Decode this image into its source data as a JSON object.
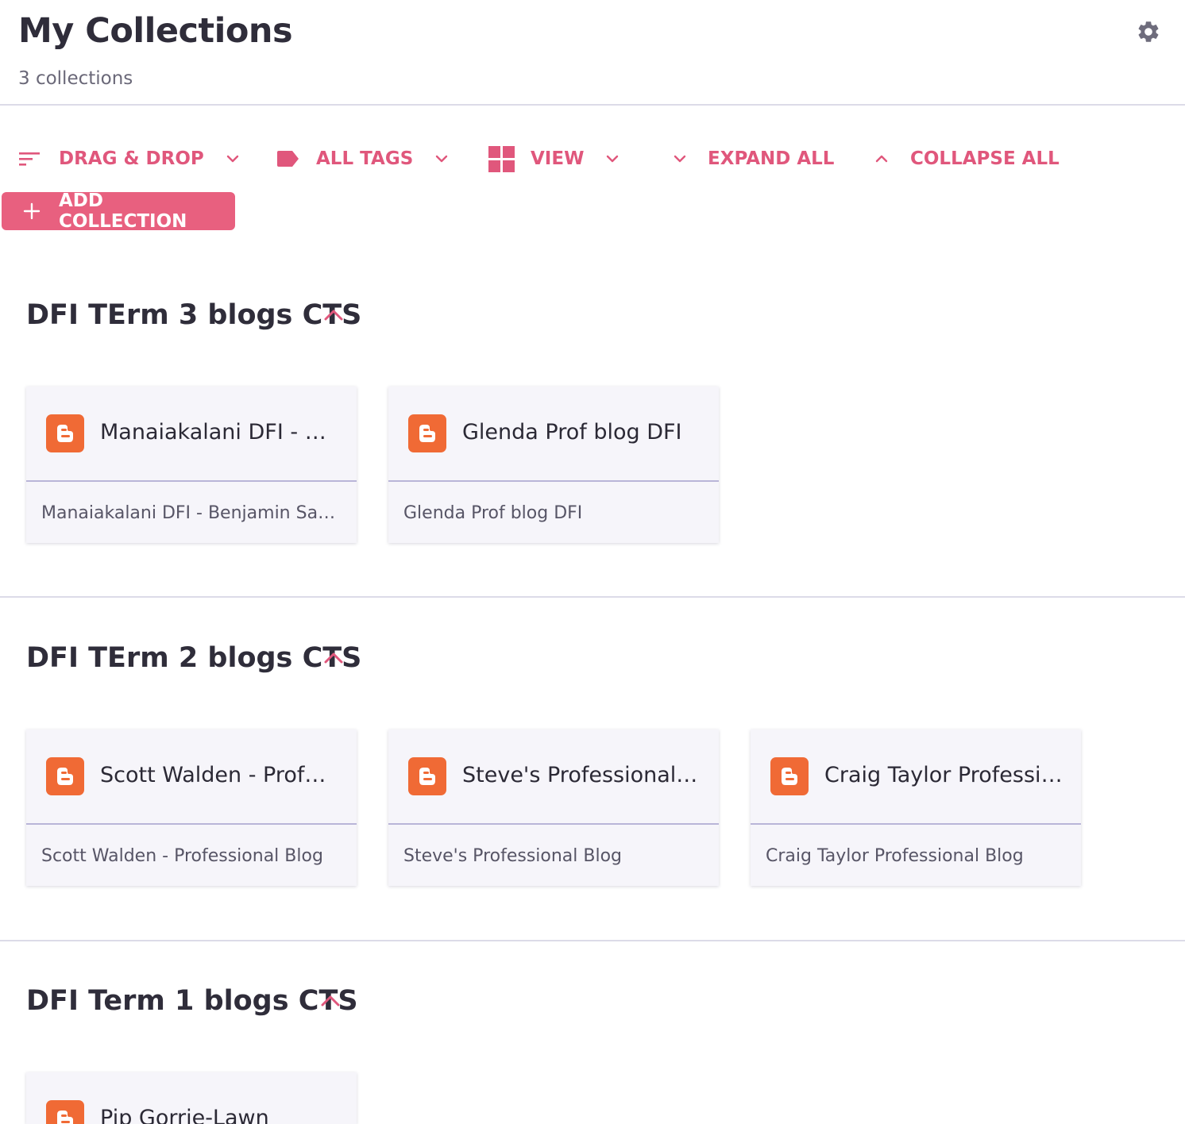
{
  "header": {
    "title": "My Collections",
    "count": "3 collections"
  },
  "toolbar": {
    "drag_drop": "DRAG & DROP",
    "all_tags": "ALL TAGS",
    "view": "VIEW",
    "expand_all": "EXPAND ALL",
    "collapse_all": "COLLAPSE ALL",
    "add_collection": "ADD COLLECTION"
  },
  "colors": {
    "accent": "#e0577c",
    "button": "#e8607f",
    "blogger": "#f06a35"
  },
  "icons": {
    "settings": "gear-icon",
    "sort": "sort-icon",
    "tag": "tag-icon",
    "view": "grid-icon",
    "dropdown": "chevron-down-icon",
    "collapse": "chevron-up-icon",
    "add": "plus-icon",
    "bookmark": "blogger-icon"
  },
  "collections": [
    {
      "title": "DFI TErm 3 blogs CTS",
      "items": [
        {
          "title": "Manaiakalani DFI - Benjamin Sapolu",
          "description": "Manaiakalani DFI - Benjamin Sapolu"
        },
        {
          "title": "Glenda Prof blog DFI",
          "description": "Glenda Prof blog DFI"
        }
      ]
    },
    {
      "title": "DFI TErm 2 blogs CTS",
      "items": [
        {
          "title": "Scott Walden - Professional Blog",
          "description": "Scott Walden - Professional Blog"
        },
        {
          "title": "Steve's Professional Blog",
          "description": "Steve's Professional Blog"
        },
        {
          "title": "Craig Taylor Professional Blog",
          "description": "Craig Taylor Professional Blog"
        }
      ]
    },
    {
      "title": "DFI Term 1 blogs CTS",
      "items": [
        {
          "title": "Pip Gorrie-Lawn",
          "description": ""
        }
      ]
    }
  ]
}
